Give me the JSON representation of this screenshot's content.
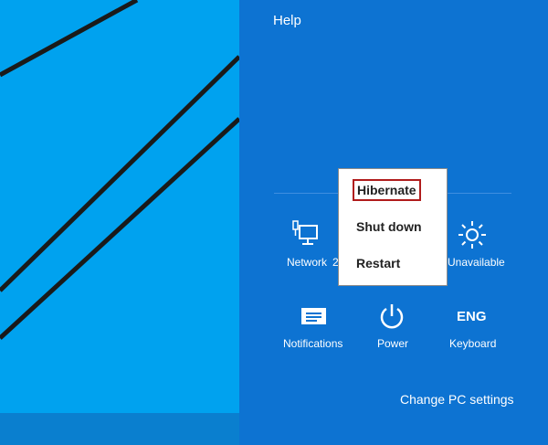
{
  "help": {
    "label": "Help"
  },
  "settings_tiles": [
    {
      "label": "Network",
      "icon": "network-icon"
    },
    {
      "label": "Unavailable",
      "icon": "brightness-icon"
    },
    {
      "label": "Notifications",
      "icon": "notifications-icon"
    },
    {
      "label": "Power",
      "icon": "power-icon"
    },
    {
      "label": "ENG",
      "sublabel": "Keyboard",
      "icon": "keyboard-icon"
    }
  ],
  "power_menu": {
    "items": [
      "Hibernate",
      "Shut down",
      "Restart"
    ],
    "highlighted": "Hibernate"
  },
  "network_partial_text": "2",
  "change_pc_settings": {
    "label": "Change PC settings"
  },
  "colors": {
    "desktop": "#00a2ef",
    "charm_bar": "#0d73d2",
    "highlight_border": "#b01c1c"
  }
}
